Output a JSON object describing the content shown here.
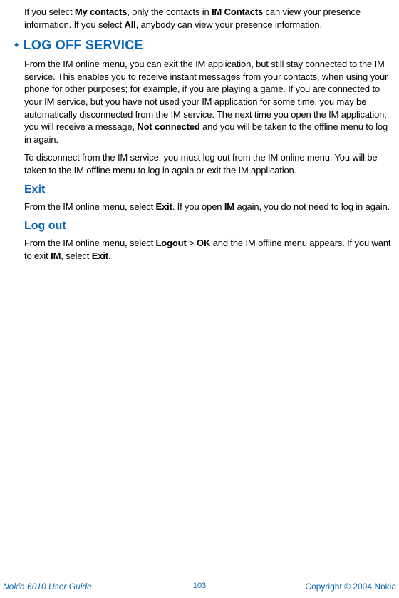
{
  "intro": {
    "p1_a": "If you select ",
    "p1_b": "My contacts",
    "p1_c": ", only the contacts in ",
    "p1_d": "IM Contacts",
    "p1_e": " can view your presence information. If you select ",
    "p1_f": "All",
    "p1_g": ", anybody can view your presence information."
  },
  "section": {
    "bullet": "•",
    "title": "LOG OFF SERVICE",
    "p1_a": "From the IM online menu, you can exit the IM application, but still stay connected to the IM service. This enables you to receive instant messages from your contacts, when using your phone for other purposes; for example, if you are playing a game. If you are connected to your IM service, but you have not used your IM application for some time, you may be automatically disconnected from the IM service. The next time you open the IM application, you will receive a message, ",
    "p1_b": "Not connected",
    "p1_c": " and you will be taken to the offline menu to log in again.",
    "p2": "To disconnect from the IM service, you must log out from the IM online menu. You will be taken to the IM offline menu to log in again or exit the IM application."
  },
  "exit": {
    "title": "Exit",
    "p_a": "From the IM online menu, select ",
    "p_b": "Exit",
    "p_c": ". If you open ",
    "p_d": "IM",
    "p_e": " again, you do not need to log in again."
  },
  "logout": {
    "title": "Log out",
    "p_a": "From the IM online menu, select ",
    "p_b": "Logout",
    "p_c": " > ",
    "p_d": "OK",
    "p_e": " and the IM offline menu appears. If you want to exit ",
    "p_f": "IM",
    "p_g": ", select ",
    "p_h": "Exit",
    "p_i": "."
  },
  "footer": {
    "left": "Nokia 6010 User Guide",
    "center": "103",
    "right": "Copyright © 2004 Nokia"
  }
}
